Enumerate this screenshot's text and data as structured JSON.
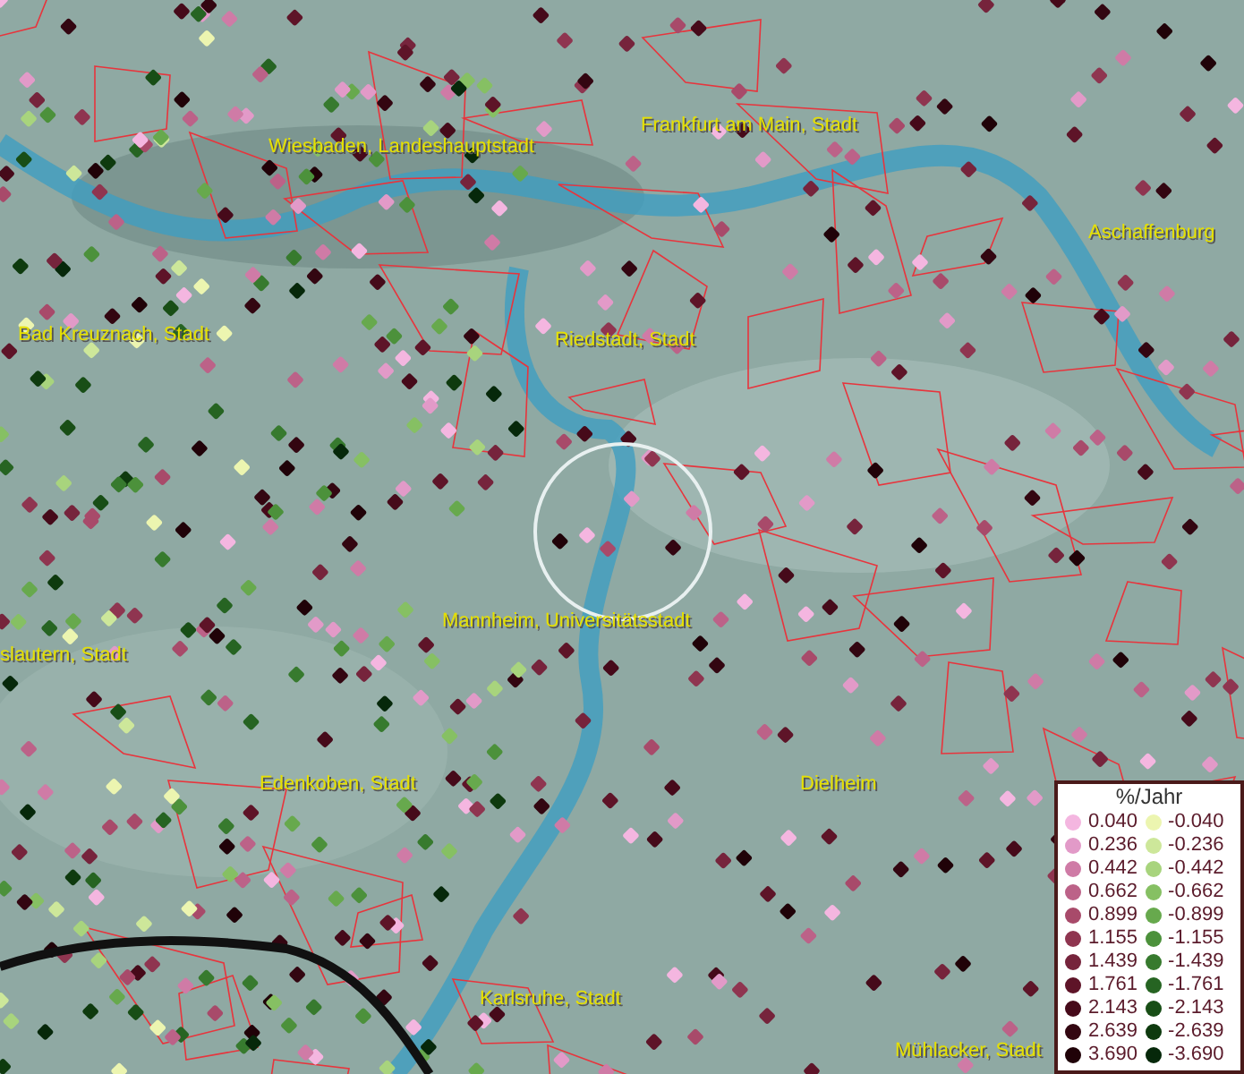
{
  "map": {
    "labels": [
      {
        "text": "Wiesbaden, Landeshauptstadt"
      },
      {
        "text": "Frankfurt am Main, Stadt"
      },
      {
        "text": "Aschaffenburg"
      },
      {
        "text": "Bad Kreuznach, Stadt"
      },
      {
        "text": "Riedstadt, Stadt"
      },
      {
        "text": "Mannheim, Universitätsstadt"
      },
      {
        "text": "slautern, Stadt"
      },
      {
        "text": "Edenkoben, Stadt"
      },
      {
        "text": "Dielheim"
      },
      {
        "text": "Karlsruhe, Stadt"
      },
      {
        "text": "Mühlacker, Stadt"
      }
    ]
  },
  "legend": {
    "title": "%/Jahr",
    "columns": [
      [
        {
          "label": "0.040",
          "color": "#f4b6e0"
        },
        {
          "label": "0.236",
          "color": "#e29ac8"
        },
        {
          "label": "0.442",
          "color": "#cf7ba6"
        },
        {
          "label": "0.662",
          "color": "#bc6288"
        },
        {
          "label": "0.899",
          "color": "#a84a6a"
        },
        {
          "label": "1.155",
          "color": "#8f3550"
        },
        {
          "label": "1.439",
          "color": "#76243c"
        },
        {
          "label": "1.761",
          "color": "#5e1428"
        },
        {
          "label": "2.143",
          "color": "#460a1a"
        },
        {
          "label": "2.639",
          "color": "#330611"
        },
        {
          "label": "3.690",
          "color": "#200208"
        }
      ],
      [
        {
          "label": "-0.040",
          "color": "#ecf5b0"
        },
        {
          "label": "-0.236",
          "color": "#cde79a"
        },
        {
          "label": "-0.442",
          "color": "#a8d47d"
        },
        {
          "label": "-0.662",
          "color": "#86c063"
        },
        {
          "label": "-0.899",
          "color": "#67a94d"
        },
        {
          "label": "-1.155",
          "color": "#4c913b"
        },
        {
          "label": "-1.439",
          "color": "#377a2e"
        },
        {
          "label": "-1.761",
          "color": "#266422"
        },
        {
          "label": "-2.143",
          "color": "#184e16"
        },
        {
          "label": "-2.639",
          "color": "#0e3a0e"
        },
        {
          "label": "-3.690",
          "color": "#06280a"
        }
      ]
    ]
  }
}
